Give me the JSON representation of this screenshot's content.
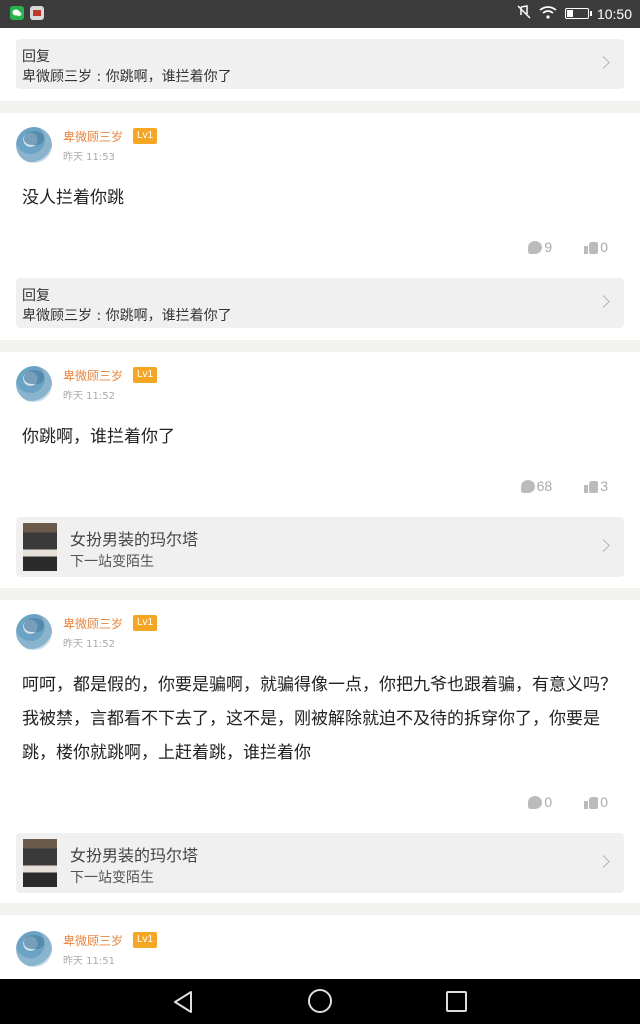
{
  "status_bar": {
    "time": "10:50",
    "battery_level": 0.3,
    "icons": [
      "wechat-icon",
      "app-icon",
      "mute-icon",
      "wifi-icon",
      "battery-icon"
    ]
  },
  "feed": {
    "top_reply": {
      "label": "回复",
      "text": "卑微顾三岁 : 你跳啊，谁拦着你了"
    },
    "posts": [
      {
        "username": "卑微顾三岁",
        "level": "Lv1",
        "time": "昨天 11:53",
        "content": "没人拦着你跳",
        "comments": "9",
        "likes": "0",
        "reply_label": "回复",
        "reply_text": "卑微顾三岁 : 你跳啊，谁拦着你了"
      },
      {
        "username": "卑微顾三岁",
        "level": "Lv1",
        "time": "昨天 11:52",
        "content": "你跳啊，谁拦着你了",
        "comments": "68",
        "likes": "3",
        "share_title": "女扮男装的玛尔塔",
        "share_subtitle": "下一站变陌生"
      },
      {
        "username": "卑微顾三岁",
        "level": "Lv1",
        "time": "昨天 11:52",
        "content": "呵呵，都是假的，你要是骗啊，就骗得像一点，你把九爷也跟着骗，有意义吗？我被禁，言都看不下去了，这不是，刚被解除就迫不及待的拆穿你了，你要是跳，楼你就跳啊，上赶着跳，谁拦着你",
        "comments": "0",
        "likes": "0",
        "share_title": "女扮男装的玛尔塔",
        "share_subtitle": "下一站变陌生"
      },
      {
        "username": "卑微顾三岁",
        "level": "Lv1",
        "time": "昨天 11:51"
      }
    ]
  },
  "nav_bar": {
    "buttons": [
      "back-icon",
      "home-icon",
      "recent-apps-icon"
    ]
  },
  "colors": {
    "username": "#e8833a",
    "level_badge": "#f5a623",
    "separator": "#f2f2ee"
  }
}
